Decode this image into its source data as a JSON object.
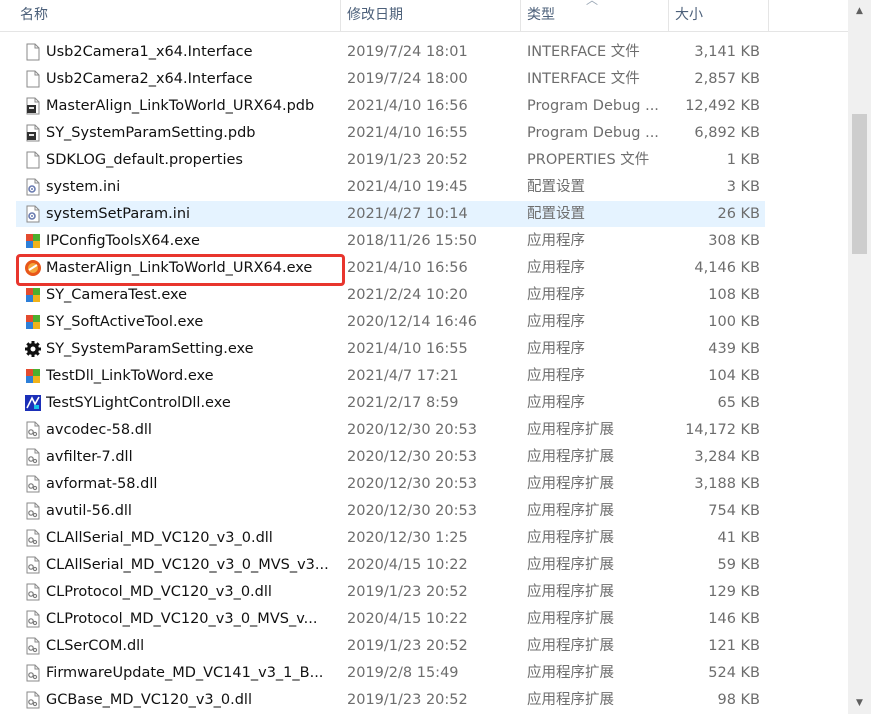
{
  "columns": {
    "name": "名称",
    "modified": "修改日期",
    "type": "类型",
    "size": "大小"
  },
  "scrollbar": {
    "up": "▲",
    "down": "▼"
  },
  "files": [
    {
      "name": "Usb2Camera1_x64.Interface",
      "date": "2019/7/24 18:01",
      "type": "INTERFACE 文件",
      "size": "3,141 KB",
      "icon": "document-icon"
    },
    {
      "name": "Usb2Camera2_x64.Interface",
      "date": "2019/7/24 18:00",
      "type": "INTERFACE 文件",
      "size": "2,857 KB",
      "icon": "document-icon"
    },
    {
      "name": "MasterAlign_LinkToWorld_URX64.pdb",
      "date": "2021/4/10 16:56",
      "type": "Program Debug ...",
      "size": "12,492 KB",
      "icon": "pdb-icon"
    },
    {
      "name": "SY_SystemParamSetting.pdb",
      "date": "2021/4/10 16:55",
      "type": "Program Debug ...",
      "size": "6,892 KB",
      "icon": "pdb-icon"
    },
    {
      "name": "SDKLOG_default.properties",
      "date": "2019/1/23 20:52",
      "type": "PROPERTIES 文件",
      "size": "1 KB",
      "icon": "document-icon"
    },
    {
      "name": "system.ini",
      "date": "2021/4/10 19:45",
      "type": "配置设置",
      "size": "3 KB",
      "icon": "ini-icon"
    },
    {
      "name": "systemSetParam.ini",
      "date": "2021/4/27 10:14",
      "type": "配置设置",
      "size": "26 KB",
      "icon": "ini-icon",
      "selected": true
    },
    {
      "name": "IPConfigToolsX64.exe",
      "date": "2018/11/26 15:50",
      "type": "应用程序",
      "size": "308 KB",
      "icon": "exe-icon"
    },
    {
      "name": "MasterAlign_LinkToWorld_URX64.exe",
      "date": "2021/4/10 16:56",
      "type": "应用程序",
      "size": "4,146 KB",
      "icon": "orange-app-icon",
      "highlighted": true
    },
    {
      "name": "SY_CameraTest.exe",
      "date": "2021/2/24 10:20",
      "type": "应用程序",
      "size": "108 KB",
      "icon": "exe-icon"
    },
    {
      "name": "SY_SoftActiveTool.exe",
      "date": "2020/12/14 16:46",
      "type": "应用程序",
      "size": "100 KB",
      "icon": "exe-icon"
    },
    {
      "name": "SY_SystemParamSetting.exe",
      "date": "2021/4/10 16:55",
      "type": "应用程序",
      "size": "439 KB",
      "icon": "gear-icon"
    },
    {
      "name": "TestDll_LinkToWord.exe",
      "date": "2021/4/7 17:21",
      "type": "应用程序",
      "size": "104 KB",
      "icon": "exe-icon"
    },
    {
      "name": "TestSYLightControlDll.exe",
      "date": "2021/2/17 8:59",
      "type": "应用程序",
      "size": "65 KB",
      "icon": "blue-app-icon"
    },
    {
      "name": "avcodec-58.dll",
      "date": "2020/12/30 20:53",
      "type": "应用程序扩展",
      "size": "14,172 KB",
      "icon": "dll-icon"
    },
    {
      "name": "avfilter-7.dll",
      "date": "2020/12/30 20:53",
      "type": "应用程序扩展",
      "size": "3,284 KB",
      "icon": "dll-icon"
    },
    {
      "name": "avformat-58.dll",
      "date": "2020/12/30 20:53",
      "type": "应用程序扩展",
      "size": "3,188 KB",
      "icon": "dll-icon"
    },
    {
      "name": "avutil-56.dll",
      "date": "2020/12/30 20:53",
      "type": "应用程序扩展",
      "size": "754 KB",
      "icon": "dll-icon"
    },
    {
      "name": "CLAllSerial_MD_VC120_v3_0.dll",
      "date": "2020/12/30 1:25",
      "type": "应用程序扩展",
      "size": "41 KB",
      "icon": "dll-icon"
    },
    {
      "name": "CLAllSerial_MD_VC120_v3_0_MVS_v3...",
      "date": "2020/4/15 10:22",
      "type": "应用程序扩展",
      "size": "59 KB",
      "icon": "dll-icon"
    },
    {
      "name": "CLProtocol_MD_VC120_v3_0.dll",
      "date": "2019/1/23 20:52",
      "type": "应用程序扩展",
      "size": "129 KB",
      "icon": "dll-icon"
    },
    {
      "name": "CLProtocol_MD_VC120_v3_0_MVS_v...",
      "date": "2020/4/15 10:22",
      "type": "应用程序扩展",
      "size": "146 KB",
      "icon": "dll-icon"
    },
    {
      "name": "CLSerCOM.dll",
      "date": "2019/1/23 20:52",
      "type": "应用程序扩展",
      "size": "121 KB",
      "icon": "dll-icon"
    },
    {
      "name": "FirmwareUpdate_MD_VC141_v3_1_B...",
      "date": "2019/2/8 15:49",
      "type": "应用程序扩展",
      "size": "524 KB",
      "icon": "dll-icon"
    },
    {
      "name": "GCBase_MD_VC120_v3_0.dll",
      "date": "2019/1/23 20:52",
      "type": "应用程序扩展",
      "size": "98 KB",
      "icon": "dll-icon"
    }
  ]
}
